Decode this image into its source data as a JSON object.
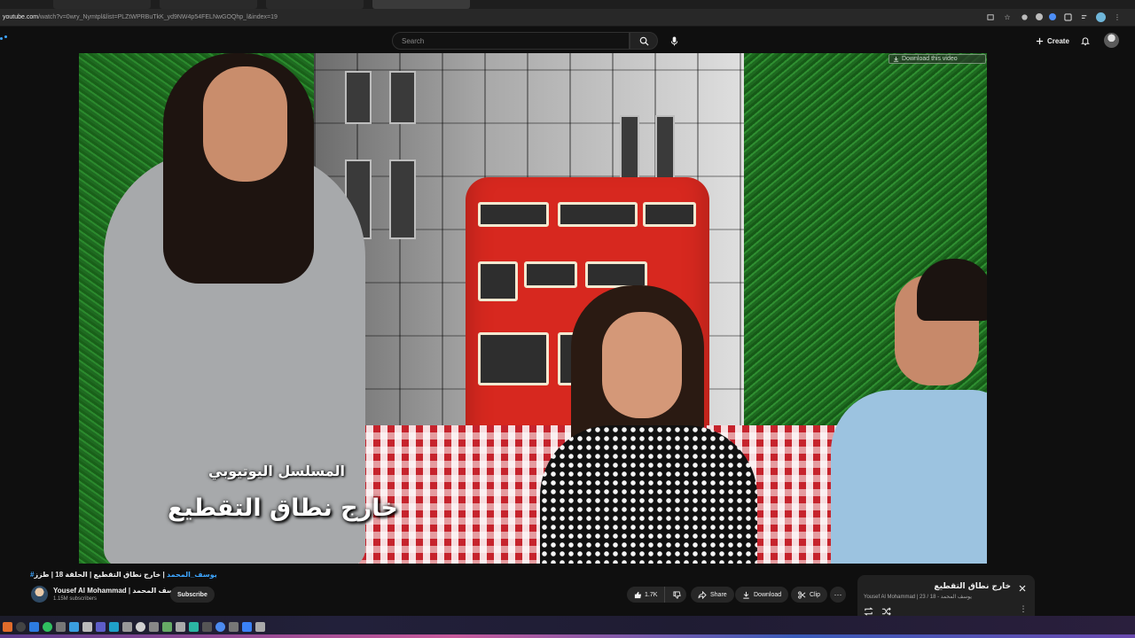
{
  "browser": {
    "url_host": "youtube.com",
    "url_path": "/watch?v=0wry_Nymtpl&list=PLZtWPRBuTkK_yd9NW4p54FELNwGOQhp_l&index=19"
  },
  "masthead": {
    "search_placeholder": "Search",
    "create_label": "Create"
  },
  "video": {
    "subtitle_small": "المسلسل اليوتيوبي",
    "subtitle_large": "خارج نطاق التقطيع",
    "download_overlay": "Download this video"
  },
  "below": {
    "hashtag": "#يوسف_المحمد",
    "title_rest": " | خارج نطاق التقطيع | الحلقة 18 | طزز",
    "channel_name": "Yousef Al Mohammad | يوسف المحمد",
    "subscribers": "1.15M subscribers",
    "subscribe_label": "Subscribe",
    "like_count": "1.7K",
    "share_label": "Share",
    "download_label": "Download",
    "clip_label": "Clip"
  },
  "playlist": {
    "title": "خارج نطاق التقطيع",
    "subtitle": "Yousef Al Mohammad | يوسف المحمد - 18 / 23"
  },
  "colors": {
    "link_blue": "#3ea6ff",
    "background": "#0f0f0f",
    "pill": "#272727"
  }
}
